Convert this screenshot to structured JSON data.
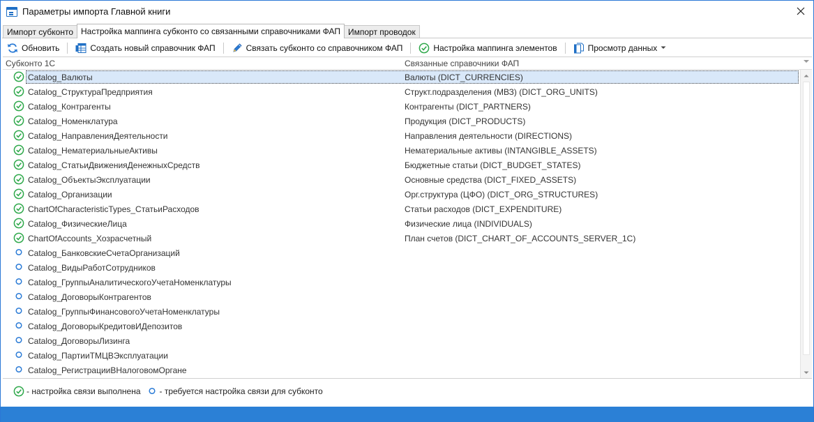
{
  "window": {
    "title": "Параметры импорта Главной книги",
    "accent_color": "#2b80d6"
  },
  "tabs": [
    {
      "label": "Импорт субконто",
      "active": false
    },
    {
      "label": "Настройка маппинга субконто со связанными справочниками ФАП",
      "active": true
    },
    {
      "label": "Импорт проводок",
      "active": false
    }
  ],
  "toolbar": {
    "refresh": "Обновить",
    "create_dict": "Создать новый справочник ФАП",
    "link": "Связать субконто со справочником ФАП",
    "mapping": "Настройка маппинга элементов",
    "view": "Просмотр данных"
  },
  "grid": {
    "columns": [
      "Субконто 1С",
      "Связанные справочники ФАП"
    ],
    "rows": [
      {
        "status": "done",
        "subconto": "Catalog_Валюты",
        "dict": "Валюты (DICT_CURRENCIES)",
        "selected": true
      },
      {
        "status": "done",
        "subconto": "Catalog_СтруктураПредприятия",
        "dict": "Структ.подразделения (МВЗ) (DICT_ORG_UNITS)"
      },
      {
        "status": "done",
        "subconto": "Catalog_Контрагенты",
        "dict": "Контрагенты  (DICT_PARTNERS)"
      },
      {
        "status": "done",
        "subconto": "Catalog_Номенклатура",
        "dict": "Продукция (DICT_PRODUCTS)"
      },
      {
        "status": "done",
        "subconto": "Catalog_НаправленияДеятельности",
        "dict": "Направления деятельности (DIRECTIONS)"
      },
      {
        "status": "done",
        "subconto": "Catalog_НематериальныеАктивы",
        "dict": "Нематериальные активы (INTANGIBLE_ASSETS)"
      },
      {
        "status": "done",
        "subconto": "Catalog_СтатьиДвиженияДенежныхСредств",
        "dict": "Бюджетные статьи (DICT_BUDGET_STATES)"
      },
      {
        "status": "done",
        "subconto": "Catalog_ОбъектыЭксплуатации",
        "dict": "Основные средства (DICT_FIXED_ASSETS)"
      },
      {
        "status": "done",
        "subconto": "Catalog_Организации",
        "dict": "Орг.структура (ЦФО) (DICT_ORG_STRUCTURES)"
      },
      {
        "status": "done",
        "subconto": "ChartOfCharacteristicTypes_СтатьиРасходов",
        "dict": "Статьи расходов (DICT_EXPENDITURE)"
      },
      {
        "status": "done",
        "subconto": "Catalog_ФизическиеЛица",
        "dict": "Физические лица (INDIVIDUALS)"
      },
      {
        "status": "done",
        "subconto": "ChartOfAccounts_Хозрасчетный",
        "dict": "План счетов (DICT_CHART_OF_ACCOUNTS_SERVER_1C)"
      },
      {
        "status": "pending",
        "subconto": "Catalog_БанковскиеСчетаОрганизаций",
        "dict": ""
      },
      {
        "status": "pending",
        "subconto": "Catalog_ВидыРаботСотрудников",
        "dict": ""
      },
      {
        "status": "pending",
        "subconto": "Catalog_ГруппыАналитическогоУчетаНоменклатуры",
        "dict": ""
      },
      {
        "status": "pending",
        "subconto": "Catalog_ДоговорыКонтрагентов",
        "dict": ""
      },
      {
        "status": "pending",
        "subconto": "Catalog_ГруппыФинансовогоУчетаНоменклатуры",
        "dict": ""
      },
      {
        "status": "pending",
        "subconto": "Catalog_ДоговорыКредитовИДепозитов",
        "dict": ""
      },
      {
        "status": "pending",
        "subconto": "Catalog_ДоговорыЛизинга",
        "dict": ""
      },
      {
        "status": "pending",
        "subconto": "Catalog_ПартииТМЦВЭксплуатации",
        "dict": ""
      },
      {
        "status": "pending",
        "subconto": "Catalog_РегистрацииВНалоговомОргане",
        "dict": ""
      }
    ]
  },
  "legend": {
    "done": "- настройка связи выполнена",
    "pending": "- требуется настройка связи для субконто"
  },
  "colors": {
    "done": "#2ea84a",
    "pending": "#2b7bd6",
    "selection": "#d9e8f9"
  }
}
